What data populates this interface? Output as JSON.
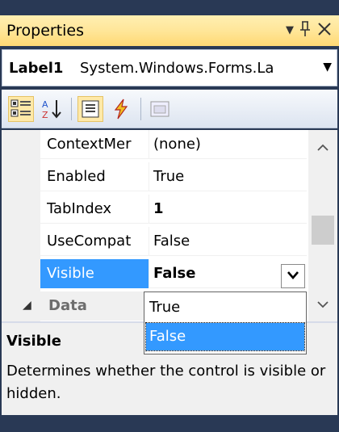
{
  "window": {
    "title": "Properties",
    "dropdown_icon": "▼",
    "pin_icon": "pin-icon",
    "close_icon": "close-icon"
  },
  "object_selector": {
    "name": "Label1",
    "type": "System.Windows.Forms.La"
  },
  "toolbar": {
    "buttons": [
      {
        "icon": "categorized-icon",
        "active": true
      },
      {
        "icon": "alphabetical-icon",
        "active": false
      },
      {
        "icon": "properties-icon",
        "active": true
      },
      {
        "icon": "events-icon",
        "active": false
      },
      {
        "icon": "property-pages-icon",
        "active": false
      }
    ]
  },
  "grid": {
    "rows": [
      {
        "name": "ContextMer",
        "value": "(none)",
        "bold": false
      },
      {
        "name": "Enabled",
        "value": "True",
        "bold": false
      },
      {
        "name": "TabIndex",
        "value": "1",
        "bold": true
      },
      {
        "name": "UseCompat",
        "value": "False",
        "bold": false
      },
      {
        "name": "Visible",
        "value": "False",
        "bold": true,
        "selected": true
      }
    ],
    "category": {
      "label": "Data",
      "expanded": true
    }
  },
  "dropdown": {
    "options": [
      "True",
      "False"
    ],
    "selected": "False"
  },
  "description": {
    "title": "Visible",
    "text": "Determines whether the control is visible or hidden."
  },
  "colors": {
    "selection": "#3399ff",
    "frame": "#293955",
    "titlebar": "#ffe699"
  }
}
